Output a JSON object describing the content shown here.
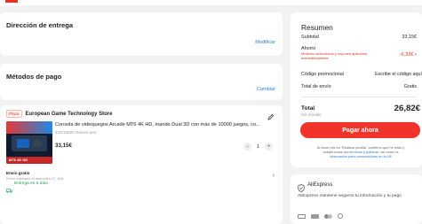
{
  "colors": {
    "accent": "#e8321f",
    "link": "#2a7bd4",
    "success": "#21a04a"
  },
  "address": {
    "title": "Dirección de entrega",
    "action": "Modificar"
  },
  "payment": {
    "title": "Métodos de pago",
    "action": "Cambiar"
  },
  "store": {
    "badge": "Plaza",
    "name": "European Game Technology Store",
    "edit_icon": "pencil-icon",
    "product": {
      "image_caption": "MT6 4K HD",
      "title": "Consola de videojuegos Arcade MT6 4K HD, mando Dual 3D con más de 10000 juegos, co...",
      "variant": "32G/10000 Games azul",
      "price": "33,15€",
      "quantity": "1"
    },
    "shipping": {
      "title": "Envío gratis",
      "detail": "Envío estimado el miércoles 27 JUN",
      "delivery": "Entrega en 5 días"
    }
  },
  "summary": {
    "title": "Resumen",
    "subtotal_label": "Subtotal",
    "subtotal_value": "33,15€",
    "savings_label": "Ahorro",
    "savings_value": "-6,33€",
    "savings_note": "Mínimos descuentos y cupones aplicados automáticamente",
    "promo_label": "Código promocional",
    "promo_value": "Escribe el código aquí",
    "shipping_label": "Total de envío",
    "shipping_value": "Gratis",
    "total_label": "Total",
    "total_value": "26,82€",
    "tax_note": "IVA incluido",
    "pay_button": "Pagar ahora",
    "legal_line1": "Al hacer clic en 'Realizar pedido', confirmo que he leído y",
    "legal_line2_pre": "acepto todos los ",
    "legal_terms": "términos y políticas",
    "legal_line2_post": ", así como la",
    "legal_info": "información para consumidores en la UE"
  },
  "security": {
    "brand": "AliExpress",
    "text": "AliExpress mantiene seguros tu información y tu pago",
    "icon": "shield-check-icon"
  }
}
